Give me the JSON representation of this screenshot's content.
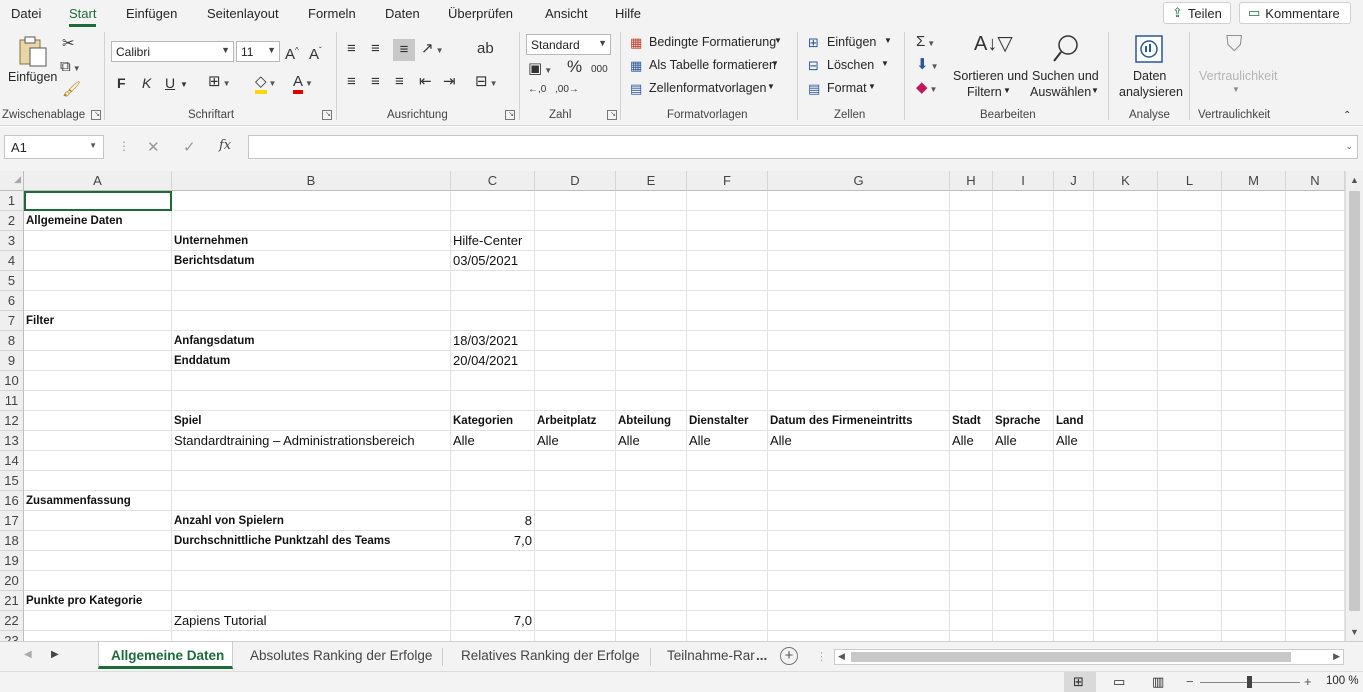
{
  "menu": {
    "tabs": [
      "Datei",
      "Start",
      "Einfügen",
      "Seitenlayout",
      "Formeln",
      "Daten",
      "Überprüfen",
      "Ansicht",
      "Hilfe"
    ],
    "share_label": "Teilen",
    "comments_label": "Kommentare",
    "accent_color": "#1d6b39"
  },
  "ribbon": {
    "clipboard": {
      "paste_label": "Einfügen",
      "group_label": "Zwischenablage"
    },
    "font": {
      "family": "Calibri",
      "size": "11",
      "group_label": "Schriftart",
      "bold": "F",
      "italic": "K",
      "underline": "U"
    },
    "alignment": {
      "group_label": "Ausrichtung"
    },
    "number": {
      "format": "Standard",
      "group_label": "Zahl"
    },
    "styles": {
      "cond_format": "Bedingte Formatierung",
      "table_format": "Als Tabelle formatieren",
      "cell_styles": "Zellenformatvorlagen",
      "group_label": "Formatvorlagen"
    },
    "cells": {
      "insert": "Einfügen",
      "delete": "Löschen",
      "format": "Format",
      "group_label": "Zellen"
    },
    "editing": {
      "sort_line1": "Sortieren und",
      "sort_line2": "Filtern",
      "find_line1": "Suchen und",
      "find_line2": "Auswählen",
      "group_label": "Bearbeiten"
    },
    "analysis": {
      "line1": "Daten",
      "line2": "analysieren",
      "group_label": "Analyse"
    },
    "sensitivity": {
      "label": "Vertraulichkeit",
      "group_label": "Vertraulichkeit"
    }
  },
  "formula_bar": {
    "name_box": "A1",
    "fx": "fx",
    "formula": ""
  },
  "columns": [
    "A",
    "B",
    "C",
    "D",
    "E",
    "F",
    "G",
    "H",
    "I",
    "J",
    "K",
    "L",
    "M",
    "N"
  ],
  "rows": [
    "1",
    "2",
    "3",
    "4",
    "5",
    "6",
    "7",
    "8",
    "9",
    "10",
    "11",
    "12",
    "13",
    "14",
    "15",
    "16",
    "17",
    "18",
    "19",
    "20",
    "21",
    "22",
    "23"
  ],
  "cells": {
    "A2": "Allgemeine Daten",
    "B3": "Unternehmen",
    "C3": "Hilfe-Center",
    "B4": "Berichtsdatum",
    "C4": "03/05/2021",
    "A7": "Filter",
    "B8": "Anfangsdatum",
    "C8": "18/03/2021",
    "B9": "Enddatum",
    "C9": "20/04/2021",
    "B12": "Spiel",
    "C12": "Kategorien",
    "D12": "Arbeitplatz",
    "E12": "Abteilung",
    "F12": "Dienstalter",
    "G12": "Datum des Firmeneintritts",
    "H12": "Stadt",
    "I12": "Sprache",
    "J12": "Land",
    "B13": "Standardtraining – Administrationsbereich",
    "C13": "Alle",
    "D13": "Alle",
    "E13": "Alle",
    "F13": "Alle",
    "G13": "Alle",
    "H13": "Alle",
    "I13": "Alle",
    "J13": "Alle",
    "A16": "Zusammenfassung",
    "B17": "Anzahl von Spielern",
    "C17": "8",
    "B18": "Durchschnittliche Punktzahl des Teams",
    "C18": "7,0",
    "A21": "Punkte pro Kategorie",
    "B22": "Zapiens Tutorial",
    "C22": "7,0"
  },
  "sheets": [
    "Allgemeine Daten",
    "Absolutes Ranking der Erfolge",
    "Relatives Ranking der Erfolge",
    "Teilnahme-Rar"
  ],
  "sheet_more": "...",
  "status": {
    "zoom": "100 %"
  }
}
